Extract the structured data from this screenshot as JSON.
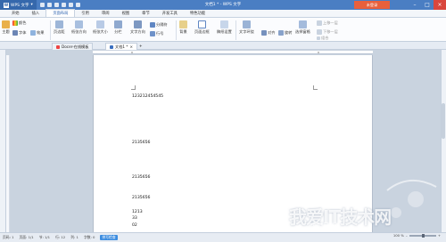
{
  "titlebar": {
    "app_label": "WPS 文字",
    "window_title": "文档1 * - WPS 文字",
    "login_label": "未登录"
  },
  "menubar": {
    "items": [
      "开始",
      "插入",
      "页面布局",
      "引用",
      "审阅",
      "视图",
      "章节",
      "开发工具",
      "特色功能"
    ],
    "active": "页面布局"
  },
  "ribbon": {
    "theme": "主题",
    "color": "颜色",
    "font": "字体",
    "effect": "效果",
    "margins": "页边距",
    "orientation": "纸张方向",
    "size": "纸张大小",
    "columns": "分栏",
    "direction": "文字方向",
    "line_number": "行号",
    "breaks": "分隔符",
    "background": "背景",
    "border": "页面边框",
    "manuscript": "稿纸设置",
    "wrap": "文字环绕",
    "align": "对齐",
    "rotate": "旋转",
    "select_pane": "选择窗格",
    "up_layer": "上移一层",
    "down_layer": "下移一层",
    "grouping": "组合"
  },
  "tabs": [
    {
      "label": "Docer-在线模板"
    },
    {
      "label": "文档1 *"
    }
  ],
  "document": {
    "lines": [
      "123212454545",
      "2135656",
      "2135656",
      "2135656",
      "1213",
      "33",
      "02"
    ]
  },
  "status": {
    "page_no": "页码: 1",
    "pages": "页面: 1/1",
    "section": "节: 1/1",
    "row": "行: 12",
    "col": "列: 1",
    "words": "字数: 0",
    "spell": "拼写检查",
    "zoom": "100 %"
  },
  "watermark": {
    "text": "我爱IT技术网",
    "sub": "www.52ij.com"
  },
  "colors": {
    "title_bg": "#4a7ec3",
    "login_btn": "#e8603c",
    "close_btn": "#d9463d",
    "page_bg": "#ffffff",
    "workspace": "#c9d3df"
  }
}
